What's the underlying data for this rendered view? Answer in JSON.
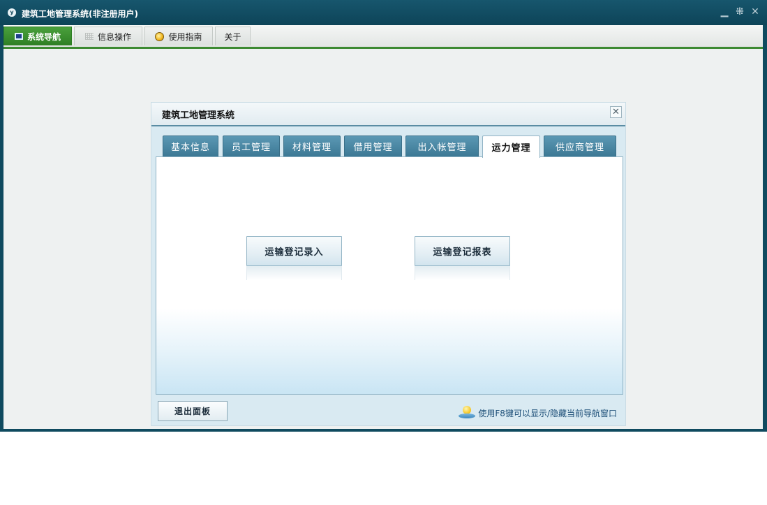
{
  "window": {
    "title": "建筑工地管理系统(非注册用户)",
    "logo_text": "y",
    "controls": [
      "minimize-icon",
      "restore-icon",
      "close-icon"
    ]
  },
  "menu": [
    {
      "label": "系统导航",
      "icon": "monitor-icon",
      "active": true
    },
    {
      "label": "信息操作",
      "icon": "grid-icon",
      "active": false
    },
    {
      "label": "使用指南",
      "icon": "guide-icon",
      "active": false
    },
    {
      "label": "关于",
      "icon": "",
      "active": false
    }
  ],
  "panel": {
    "title": "建筑工地管理系统",
    "close_symbol": "✕",
    "tabs": [
      {
        "label": "基本信息",
        "active": false
      },
      {
        "label": "员工管理",
        "active": false
      },
      {
        "label": "材料管理",
        "active": false
      },
      {
        "label": "借用管理",
        "active": false
      },
      {
        "label": "出入帐管理",
        "active": false
      },
      {
        "label": "运力管理",
        "active": true
      },
      {
        "label": "供应商管理",
        "active": false
      }
    ],
    "actions": [
      {
        "label": "运输登记录入"
      },
      {
        "label": "运输登记报表"
      }
    ],
    "exit_label": "退出面板",
    "hint": "使用F8键可以显示/隐藏当前导航窗口"
  },
  "colors": {
    "titlebar": "#0d4458",
    "menu_active": "#3d8a32",
    "tab": "#4a88a5",
    "panel_bg": "#d9eaf2"
  }
}
